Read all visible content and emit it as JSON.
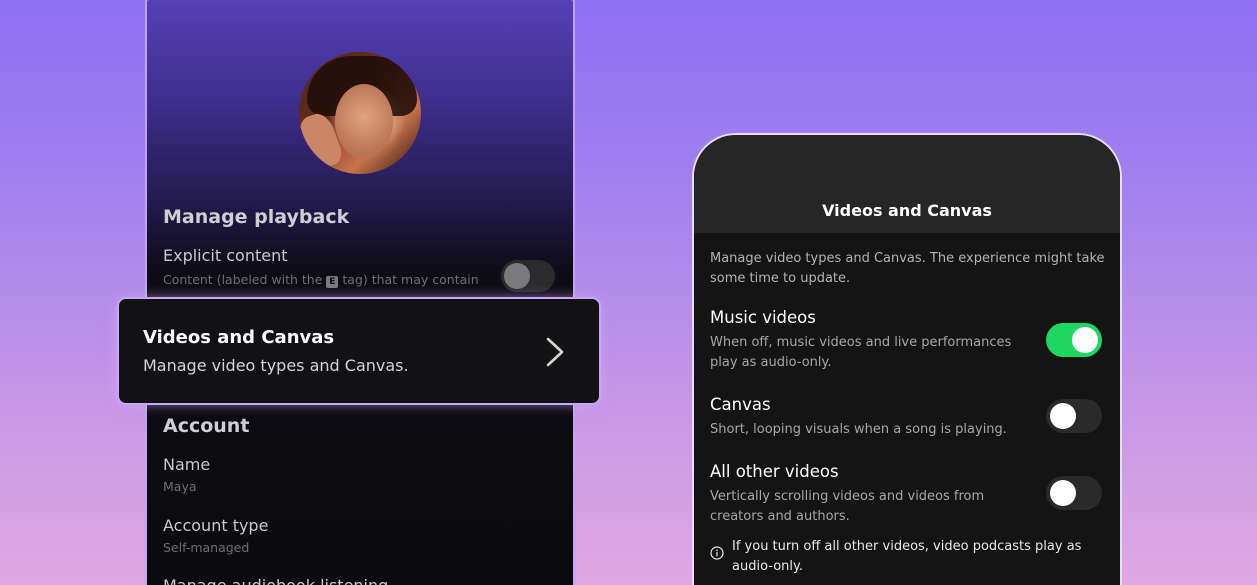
{
  "left_screen": {
    "sections": {
      "playback": "Manage playback",
      "account": "Account"
    },
    "explicit": {
      "title": "Explicit content",
      "desc_before": "Content (labeled with the ",
      "badge": "E",
      "desc_after": " tag) that may contain"
    },
    "account_rows": [
      {
        "title": "Name",
        "value": "Maya"
      },
      {
        "title": "Account type",
        "value": "Self-managed"
      }
    ],
    "partial_row": "Manage audiobook listening"
  },
  "highlight_card": {
    "title": "Videos and Canvas",
    "subtitle": "Manage video types and Canvas."
  },
  "right_screen": {
    "header_title": "Videos and Canvas",
    "intro": "Manage video types and Canvas. The experience might take some time to update.",
    "settings": [
      {
        "title": "Music videos",
        "desc": "When off, music videos and live performances play as audio-only.",
        "on": true
      },
      {
        "title": "Canvas",
        "desc": "Short, looping visuals when a song is playing.",
        "on": false
      },
      {
        "title": "All other videos",
        "desc": "Vertically scrolling videos and videos from creators and authors.",
        "on": false
      }
    ],
    "info_note": "If you turn off all other videos, video podcasts play as audio-only."
  },
  "colors": {
    "accent_green": "#1ed760",
    "highlight_border": "#c9a7f5",
    "background_top": "#8d70f3",
    "background_bottom": "#e0a8e3"
  },
  "icons": {
    "chevron": "chevron-right-icon",
    "info": "info-icon"
  }
}
